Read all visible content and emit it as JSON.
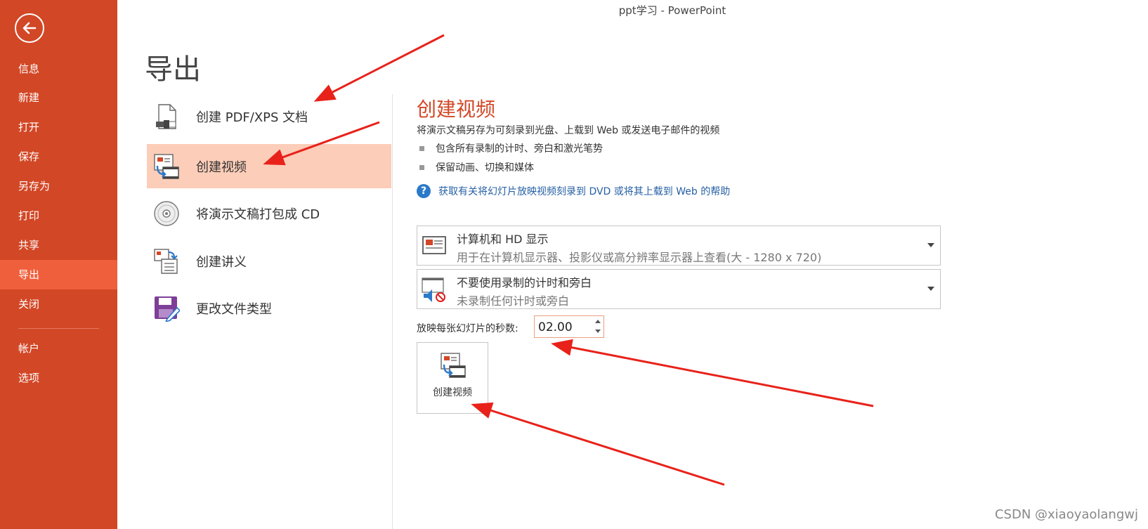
{
  "window": {
    "title": "ppt学习 - PowerPoint"
  },
  "sidebar": {
    "back_icon": "back-arrow-icon",
    "items": [
      {
        "label": "信息"
      },
      {
        "label": "新建"
      },
      {
        "label": "打开"
      },
      {
        "label": "保存"
      },
      {
        "label": "另存为"
      },
      {
        "label": "打印"
      },
      {
        "label": "共享"
      },
      {
        "label": "导出",
        "active": true
      },
      {
        "label": "关闭"
      },
      {
        "label": "帐户"
      },
      {
        "label": "选项"
      }
    ],
    "colors": {
      "background": "#D24726",
      "active": "#F05F3C"
    }
  },
  "page": {
    "title": "导出"
  },
  "export_options": [
    {
      "label": "创建 PDF/XPS 文档",
      "icon": "pdf-document-icon"
    },
    {
      "label": "创建视频",
      "icon": "video-icon",
      "active": true
    },
    {
      "label": "将演示文稿打包成 CD",
      "icon": "cd-icon"
    },
    {
      "label": "创建讲义",
      "icon": "handout-icon"
    },
    {
      "label": "更改文件类型",
      "icon": "file-type-icon"
    }
  ],
  "detail": {
    "title": "创建视频",
    "description": "将演示文稿另存为可刻录到光盘、上载到 Web 或发送电子邮件的视频",
    "bullets": [
      "包含所有录制的计时、旁白和激光笔势",
      "保留动画、切换和媒体"
    ],
    "help_link": "获取有关将幻灯片放映视频刻录到 DVD 或将其上载到 Web 的帮助",
    "quality_dropdown": {
      "main": "计算机和 HD 显示",
      "sub": "用于在计算机显示器、投影仪或高分辨率显示器上查看(大 - 1280 x 720)",
      "icon": "monitor-icon"
    },
    "timing_dropdown": {
      "main": "不要使用录制的计时和旁白",
      "sub": "未录制任何计时或旁白",
      "icon": "no-narration-icon"
    },
    "seconds_label": "放映每张幻灯片的秒数:",
    "seconds_value": "02.00",
    "create_button_label": "创建视频"
  },
  "watermark": "CSDN @xiaoyaolangwj",
  "accent_color": "#D24726"
}
